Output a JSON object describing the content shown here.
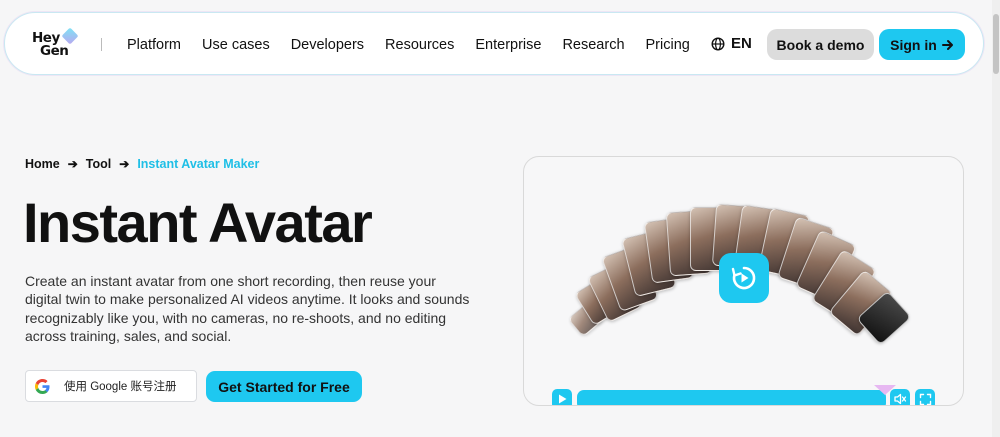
{
  "nav": {
    "logo_line1": "Hey",
    "logo_line2": "Gen",
    "links": [
      "Platform",
      "Use cases",
      "Developers",
      "Resources",
      "Enterprise",
      "Research",
      "Pricing"
    ],
    "language": "EN",
    "demo_label": "Book a demo",
    "signin_label": "Sign in"
  },
  "breadcrumb": {
    "items": [
      "Home",
      "Tool"
    ],
    "current": "Instant Avatar Maker"
  },
  "hero": {
    "title": "Instant Avatar",
    "description": "Create an instant avatar from one short recording, then reuse your digital twin to make personalized AI videos anytime. It looks and sounds recognizably like you, with no cameras, no re-shoots, and no editing across training, sales, and social.",
    "google_label": "使用 Google 账号注册",
    "cta_label": "Get Started for Free"
  },
  "video": {
    "progress": 1.0
  },
  "colors": {
    "accent": "#1ec8f0",
    "breadcrumb_current": "#1fbfe6",
    "demo_button": "#dcdcdc"
  },
  "icons": [
    "globe-icon",
    "arrow-right-icon",
    "google-icon",
    "replay-icon",
    "play-icon",
    "mute-icon",
    "fullscreen-icon"
  ]
}
